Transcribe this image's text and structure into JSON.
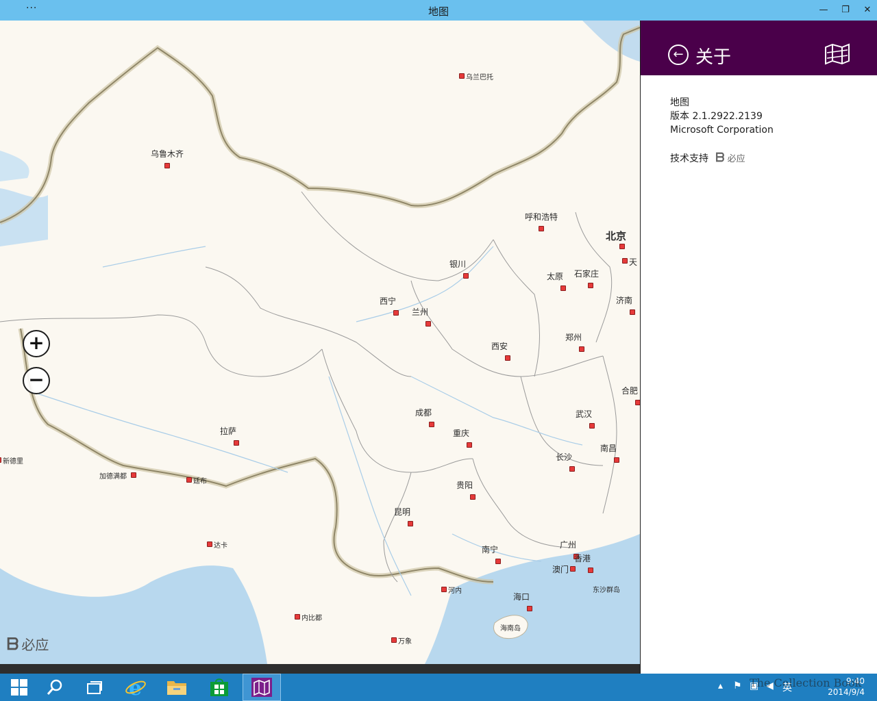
{
  "window": {
    "title": "地图",
    "menu_dots": "···",
    "min_glyph": "—",
    "restore_glyph": "❐",
    "close_glyph": "✕"
  },
  "map": {
    "attribution": "必应",
    "zoom_in": "+",
    "zoom_out": "−",
    "cities": [
      {
        "name": "乌兰巴托",
        "kind": "small"
      },
      {
        "name": "乌鲁木齐",
        "kind": "city"
      },
      {
        "name": "呼和浩特",
        "kind": "city"
      },
      {
        "name": "北京",
        "kind": "capital"
      },
      {
        "name": "天",
        "kind": "city"
      },
      {
        "name": "银川",
        "kind": "city"
      },
      {
        "name": "太原",
        "kind": "city"
      },
      {
        "name": "石家庄",
        "kind": "city"
      },
      {
        "name": "济南",
        "kind": "city"
      },
      {
        "name": "西宁",
        "kind": "city"
      },
      {
        "name": "兰州",
        "kind": "city"
      },
      {
        "name": "郑州",
        "kind": "city"
      },
      {
        "name": "西安",
        "kind": "city"
      },
      {
        "name": "合肥",
        "kind": "city"
      },
      {
        "name": "成都",
        "kind": "city"
      },
      {
        "name": "武汉",
        "kind": "city"
      },
      {
        "name": "拉萨",
        "kind": "city"
      },
      {
        "name": "重庆",
        "kind": "city"
      },
      {
        "name": "长沙",
        "kind": "city"
      },
      {
        "name": "南昌",
        "kind": "city"
      },
      {
        "name": "新德里",
        "kind": "small"
      },
      {
        "name": "加德满都",
        "kind": "small"
      },
      {
        "name": "廷布",
        "kind": "small"
      },
      {
        "name": "贵阳",
        "kind": "city"
      },
      {
        "name": "昆明",
        "kind": "city"
      },
      {
        "name": "达卡",
        "kind": "small"
      },
      {
        "name": "广州",
        "kind": "city"
      },
      {
        "name": "南宁",
        "kind": "city"
      },
      {
        "name": "香港",
        "kind": "city"
      },
      {
        "name": "澳门",
        "kind": "city"
      },
      {
        "name": "河内",
        "kind": "small"
      },
      {
        "name": "东沙群岛",
        "kind": "small"
      },
      {
        "name": "海口",
        "kind": "city"
      },
      {
        "name": "海南岛",
        "kind": "small"
      },
      {
        "name": "内比都",
        "kind": "small"
      },
      {
        "name": "万象",
        "kind": "small"
      }
    ]
  },
  "about_pane": {
    "title": "关于",
    "app_name": "地图",
    "version": "版本 2.1.2922.2139",
    "publisher": "Microsoft Corporation",
    "support_label": "技术支持",
    "support_brand": "必应"
  },
  "taskbar": {
    "items": [
      "start-icon",
      "search-icon",
      "task-view-icon",
      "internet-explorer-icon",
      "file-explorer-icon",
      "store-icon",
      "maps-app-icon"
    ],
    "tray": {
      "ime": "英",
      "time": "9:40",
      "date": "2014/9/4"
    }
  },
  "watermark": "The Collection Book",
  "colors": {
    "titlebar": "#6ac0ee",
    "pane_header": "#4a004a",
    "taskbar": "#1f7fc1",
    "map_land": "#fbf8f1",
    "water": "#b8d8ee"
  }
}
